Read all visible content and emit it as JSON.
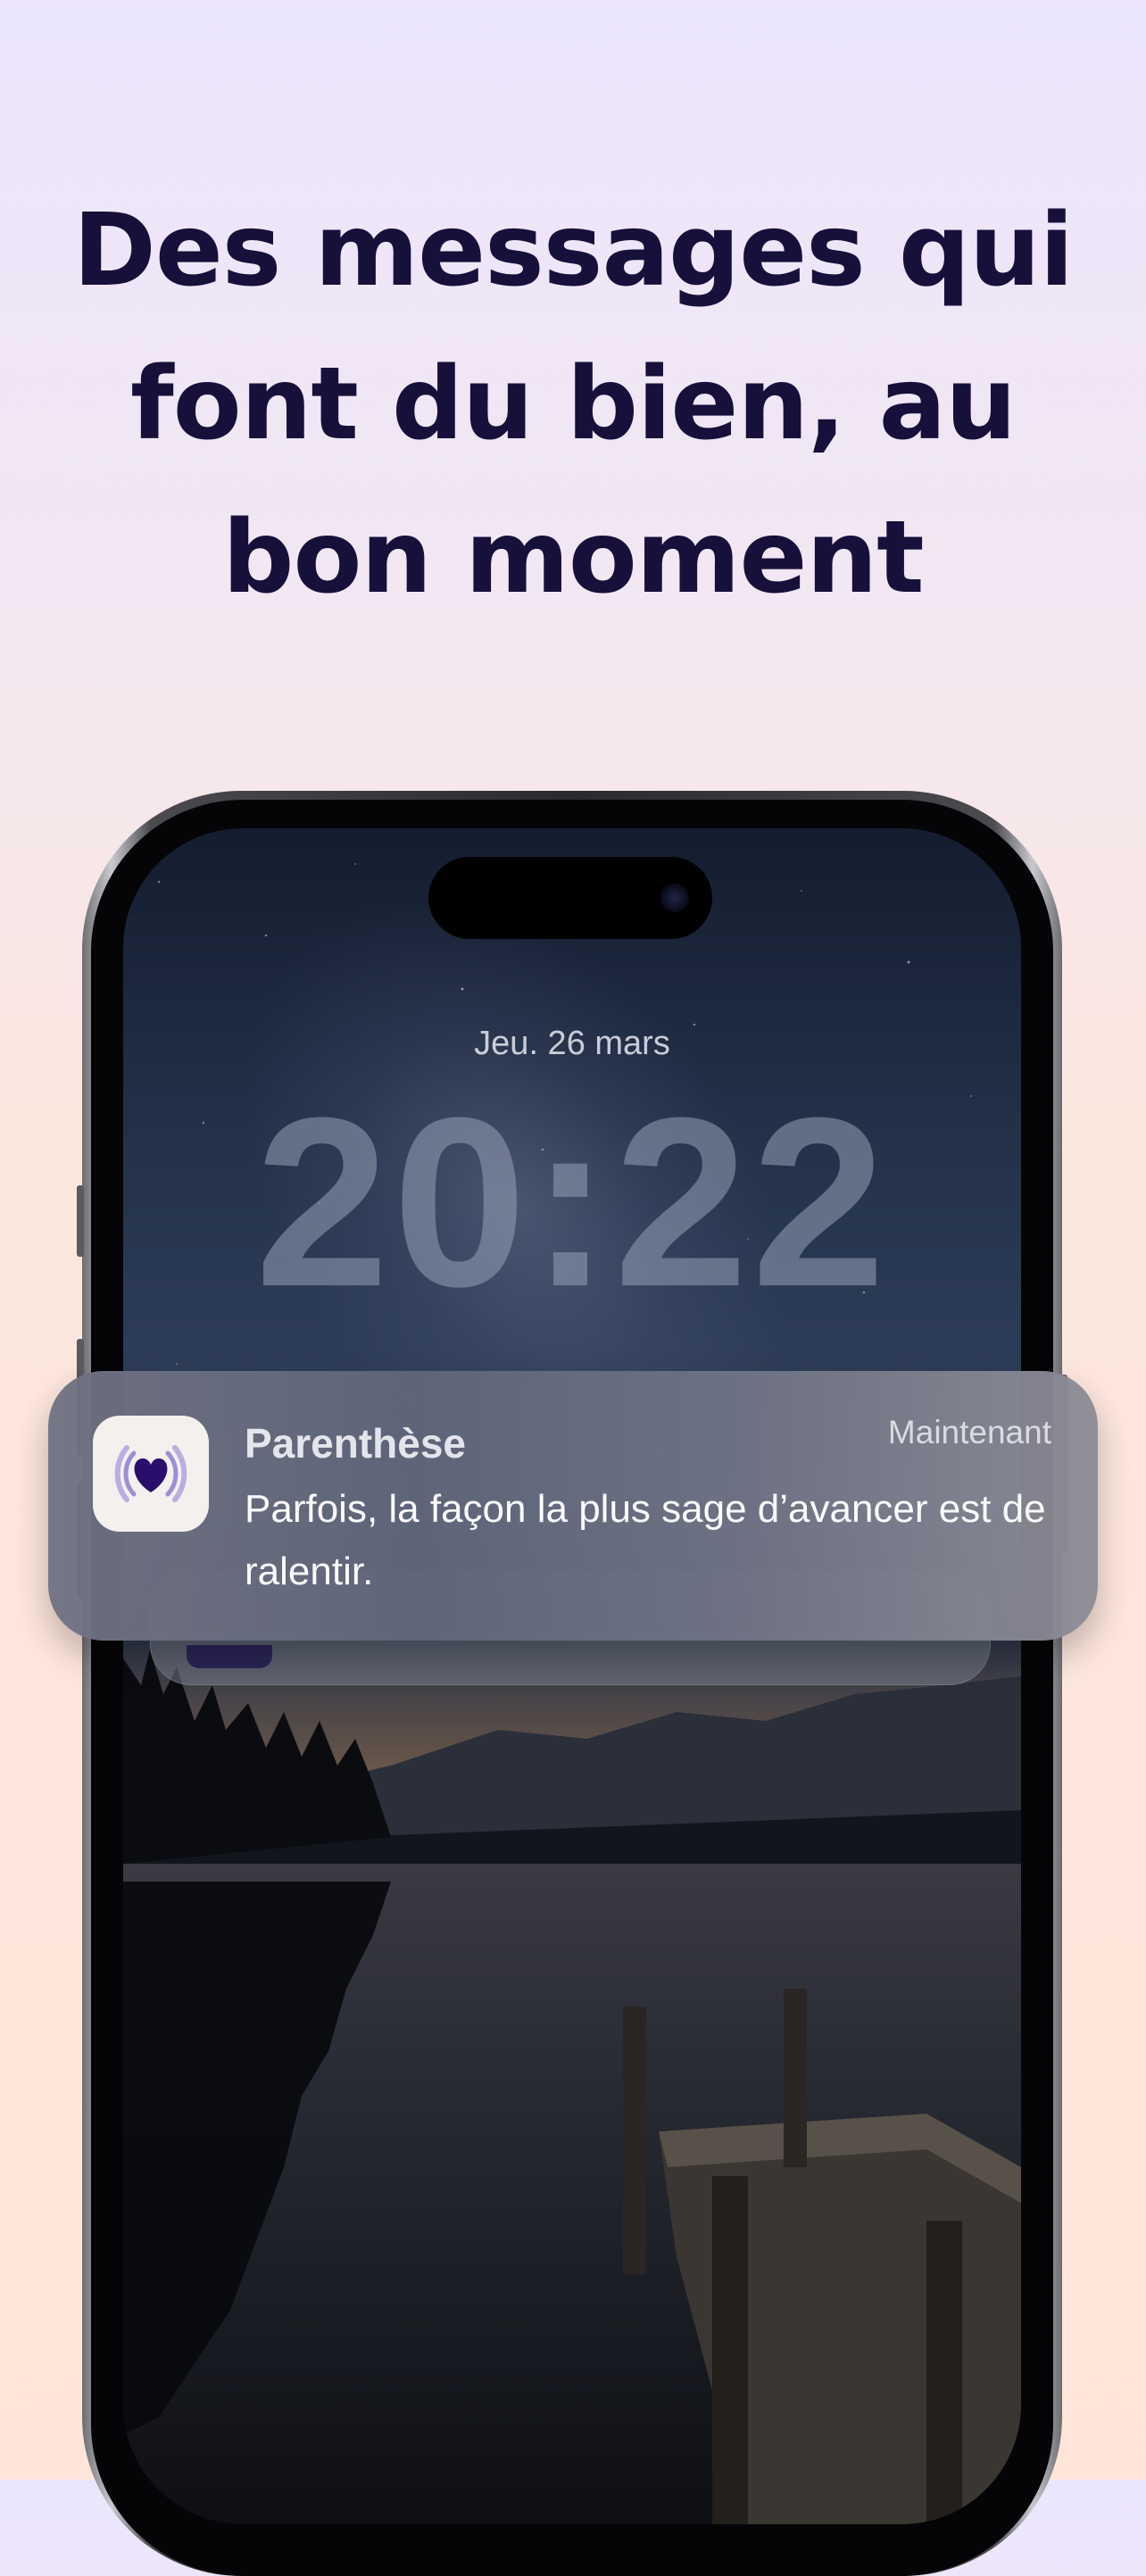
{
  "headline": "Des messages qui font du bien, au bon moment",
  "lock_screen": {
    "date": "Jeu. 26 mars",
    "time": "20:22"
  },
  "notification": {
    "app_name": "Parenthèse",
    "timestamp": "Maintenant",
    "message": "Parfois, la façon la plus sage d’avancer est de ralentir.",
    "icon": "heart-icon"
  },
  "colors": {
    "headline": "#16103b",
    "heart": "#2a0e6b",
    "background_top": "#ece6fd",
    "background_bottom": "#ffe5d9"
  }
}
